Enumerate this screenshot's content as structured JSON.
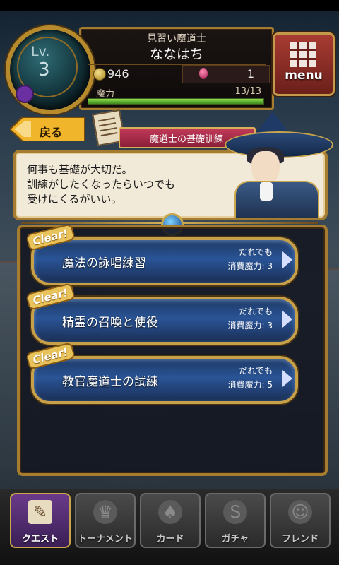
{
  "header": {
    "level_label": "Lv.",
    "level_value": "3",
    "player_title": "見習い魔道士",
    "player_name": "ななはち",
    "coins": "946",
    "gems": "1",
    "mp_label": "魔力",
    "mp_value": "13/13",
    "mp_fraction": 1.0
  },
  "menu": {
    "label": "menu"
  },
  "nav": {
    "back_label": "戻る"
  },
  "section": {
    "title": "魔道士の基礎訓練"
  },
  "dialog": {
    "lines": [
      "何事も基礎が大切だ。",
      "訓練がしたくなったらいつでも",
      "受けにくるがいい。"
    ]
  },
  "quests": [
    {
      "badge": "Clear!",
      "title": "魔法の詠唱練習",
      "who": "だれでも",
      "cost": "消費魔力: 3"
    },
    {
      "badge": "Clear!",
      "title": "精霊の召喚と使役",
      "who": "だれでも",
      "cost": "消費魔力: 3"
    },
    {
      "badge": "Clear!",
      "title": "教官魔道士の試練",
      "who": "だれでも",
      "cost": "消費魔力: 5"
    }
  ],
  "tabs": [
    {
      "label": "クエスト",
      "icon": "quest-scroll-icon",
      "active": true
    },
    {
      "label": "トーナメント",
      "icon": "tournament-icon",
      "active": false
    },
    {
      "label": "カード",
      "icon": "card-icon",
      "active": false
    },
    {
      "label": "ガチャ",
      "icon": "gacha-icon",
      "active": false
    },
    {
      "label": "フレンド",
      "icon": "friend-icon",
      "active": false
    }
  ],
  "colors": {
    "frame_gold": "#a67c30",
    "mp_bar": "#6bc23a",
    "quest_blue": "#2a5496",
    "section_red": "#c23a5a"
  }
}
